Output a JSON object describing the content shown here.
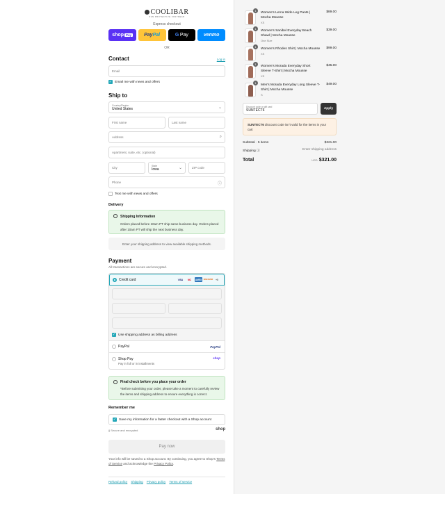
{
  "brand": {
    "name": "COOLIBAR",
    "tagline": "SUN PROTECTIVE FOR WEAR"
  },
  "express": {
    "label": "Express checkout",
    "shop_label": "shop",
    "shop_badge": "Pay",
    "paypal_a": "Pay",
    "paypal_b": "Pal",
    "gpay_g": "G",
    "gpay_label": "Pay",
    "venmo_label": "venmo",
    "or": "OR"
  },
  "contact": {
    "title": "Contact",
    "login": "Log in",
    "email_placeholder": "Email",
    "news_label": "Email me with news and offers"
  },
  "shipping": {
    "title": "Ship to",
    "country_label": "Country/Region",
    "country_value": "United States",
    "first_name": "First name",
    "last_name": "Last name",
    "address": "Address",
    "apartment": "Apartment, suite, etc. (optional)",
    "city": "City",
    "state_label": "State",
    "state_value": "Iowa",
    "zip": "ZIP code",
    "phone": "Phone",
    "text_label": "Text me with news and offers"
  },
  "delivery": {
    "title": "Delivery",
    "info_title": "Shipping Information",
    "info_text": "Orders placed before 10am PT ship same business day. Orders placed after 10am PT will ship the next business day.",
    "note": "Enter your shipping address to view available shipping methods."
  },
  "payment": {
    "title": "Payment",
    "subtitle": "All transactions are secure and encrypted.",
    "credit_card": "Credit card",
    "cards": [
      "VISA",
      "MC",
      "AMEX",
      "DISCOVER",
      "+5"
    ],
    "billing_label": "Use shipping address as billing address",
    "paypal": "PayPal",
    "paypal_logo": "PayPal",
    "shop_pay": "Shop Pay",
    "shop_pay_sub": "Pay in full or in installments",
    "shop_pay_logo": "shop"
  },
  "final_check": {
    "title": "Final check before you place your order",
    "text": "*Before submitting your order, please take a moment to carefully review the items and shipping address to ensure everything is correct."
  },
  "remember": {
    "title": "Remember me",
    "label": "Save my information for a faster checkout with a Shop account",
    "secure": "Secure and encrypted",
    "shop_logo": "shop"
  },
  "pay_now": "Pay now",
  "legal": {
    "text_a": "Your info will be saved to a Shop account. By continuing, you agree to Shop's",
    "tos": "Terms of Service",
    "text_b": "and acknowledge the",
    "privacy": "Privacy Policy",
    "text_c": "."
  },
  "footer": [
    "Refund policy",
    "Shipping",
    "Privacy policy",
    "Terms of service"
  ],
  "cart": {
    "items": [
      {
        "qty": "1",
        "name": "Women's Lerna Wide Leg Pants | Mocha Mousse",
        "variant": "XS",
        "price": "$89.00",
        "color": "#a56f5c"
      },
      {
        "qty": "1",
        "name": "Women's Sanibel Everyday Beach Shawl | Mocha Mousse",
        "variant": "One Size",
        "price": "$39.00",
        "color": "#9c6a58"
      },
      {
        "qty": "1",
        "name": "Women's Rhodes Shirt | Mocha Mousse",
        "variant": "XS",
        "price": "$99.00",
        "color": "#a77360"
      },
      {
        "qty": "1",
        "name": "Women's Morada Everyday Short Sleeve T-Shirt | Mocha Mousse",
        "variant": "XS",
        "price": "$45.00",
        "color": "#a06b59"
      },
      {
        "qty": "1",
        "name": "Men's Morada Everyday Long Sleeve T-Shirt | Mocha Mousse",
        "variant": "S",
        "price": "$49.00",
        "color": "#8e5e4f"
      }
    ],
    "discount_label": "Discount code or gift card",
    "discount_value": "SUNTECT6",
    "apply": "Apply",
    "warning_code": "SUNTECT6",
    "warning_text": "discount code isn't valid for the items in your cart",
    "subtotal_label": "Subtotal · 5 items",
    "subtotal_value": "$321.00",
    "shipping_label": "Shipping",
    "shipping_value": "Enter shipping address",
    "total_label": "Total",
    "currency": "USD",
    "total_value": "$321.00"
  }
}
